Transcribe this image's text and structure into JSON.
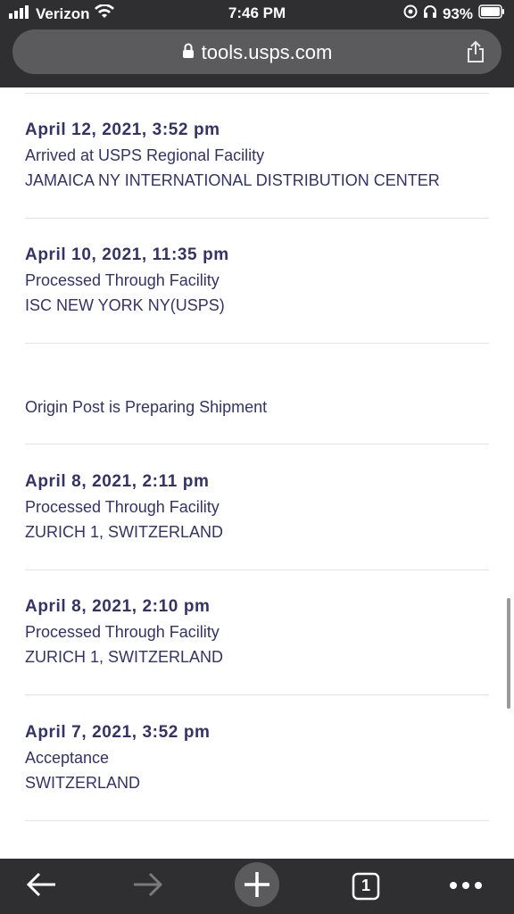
{
  "status_bar": {
    "carrier": "Verizon",
    "time": "7:46 PM",
    "battery": "93%"
  },
  "browser": {
    "url": "tools.usps.com"
  },
  "tracking_events": [
    {
      "date": "April 12, 2021, 3:52 pm",
      "status": "Arrived at USPS Regional Facility",
      "location": "JAMAICA NY INTERNATIONAL DISTRIBUTION CENTER"
    },
    {
      "date": "April 10, 2021, 11:35 pm",
      "status": "Processed Through Facility",
      "location": "ISC NEW YORK NY(USPS)"
    },
    {
      "date": "",
      "status": "Origin Post is Preparing Shipment",
      "location": ""
    },
    {
      "date": "April 8, 2021, 2:11 pm",
      "status": "Processed Through Facility",
      "location": "ZURICH 1, SWITZERLAND"
    },
    {
      "date": "April 8, 2021, 2:10 pm",
      "status": "Processed Through Facility",
      "location": "ZURICH 1, SWITZERLAND"
    },
    {
      "date": "April 7, 2021, 3:52 pm",
      "status": "Acceptance",
      "location": "SWITZERLAND"
    }
  ],
  "toolbar": {
    "tab_count": "1"
  },
  "icons": [
    "signal-icon",
    "wifi-icon",
    "location-icon",
    "headphones-icon",
    "battery-icon",
    "lock-icon",
    "share-icon",
    "back-icon",
    "forward-icon",
    "new-tab-icon",
    "tabs-icon",
    "more-icon"
  ]
}
